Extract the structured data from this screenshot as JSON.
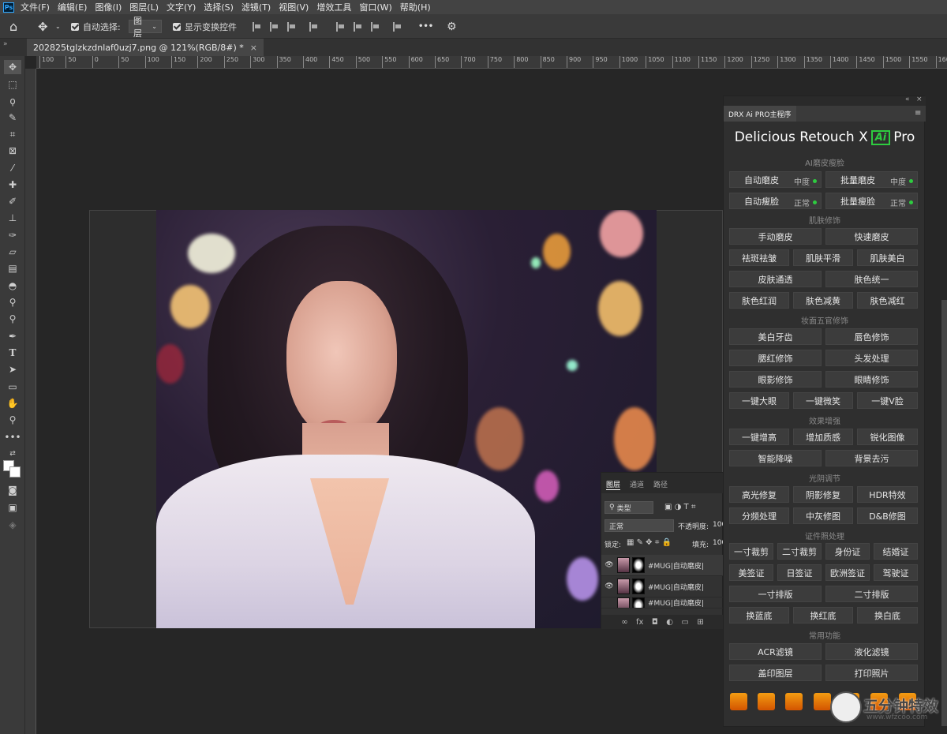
{
  "menu": [
    "文件(F)",
    "编辑(E)",
    "图像(I)",
    "图层(L)",
    "文字(Y)",
    "选择(S)",
    "滤镜(T)",
    "视图(V)",
    "增效工具",
    "窗口(W)",
    "帮助(H)"
  ],
  "options": {
    "auto_select_label": "自动选择:",
    "auto_select_value": "图层",
    "show_transform_label": "显示变换控件",
    "more": "•••"
  },
  "document_tab": {
    "title": "202825tglzkzdnlaf0uzj7.png @ 121%(RGB/8#) *",
    "close": "×"
  },
  "ruler_ticks": [
    "100",
    "50",
    "0",
    "50",
    "100",
    "150",
    "200",
    "250",
    "300",
    "350",
    "400",
    "450",
    "500",
    "550",
    "600",
    "650",
    "700",
    "750",
    "800",
    "850",
    "900",
    "950",
    "1000",
    "1050",
    "1100",
    "1150",
    "1200",
    "1250",
    "1300",
    "1350",
    "1400",
    "1450",
    "1500",
    "1550",
    "1600"
  ],
  "layers_panel": {
    "tabs": [
      "图层",
      "通道",
      "路径"
    ],
    "filter_label": "类型",
    "blend_mode": "正常",
    "opacity_label": "不透明度:",
    "opacity_value": "100",
    "lock_label": "锁定:",
    "fill_label": "填充:",
    "fill_value": "100",
    "layers": [
      {
        "name": "#MUG|自动磨皮|"
      },
      {
        "name": "#MUG|自动磨皮|"
      },
      {
        "name": "#MUG|自动磨皮|"
      }
    ]
  },
  "drx": {
    "tab_label": "DRX Ai PRO主程序",
    "title_left": "Delicious Retouch X",
    "title_badge": "Ai",
    "title_right": "Pro",
    "sections": {
      "ai": "AI磨皮瘦脸",
      "skin": "肌肤修饰",
      "makeup": "妆面五官修饰",
      "effect": "效果增强",
      "light": "光阴调节",
      "id": "证件照处理",
      "common": "常用功能"
    },
    "ai_buttons": [
      {
        "label": "自动磨皮",
        "mode": "中度"
      },
      {
        "label": "批量磨皮",
        "mode": "中度"
      },
      {
        "label": "自动瘦脸",
        "mode": "正常"
      },
      {
        "label": "批量瘦脸",
        "mode": "正常"
      }
    ],
    "skin_buttons": [
      "手动磨皮",
      "快速磨皮",
      "祛斑祛皱",
      "肌肤平滑",
      "肌肤美白",
      "皮肤通透",
      "肤色统一",
      "肤色红润",
      "肤色减黄",
      "肤色减红"
    ],
    "makeup_buttons": [
      "美白牙齿",
      "唇色修饰",
      "腮红修饰",
      "头发处理",
      "眼影修饰",
      "眼睛修饰",
      "一键大眼",
      "一键微笑",
      "一键V脸"
    ],
    "effect_buttons": [
      "一键增高",
      "增加质感",
      "锐化图像",
      "智能降噪",
      "背景去污"
    ],
    "light_buttons": [
      "高光修复",
      "阴影修复",
      "HDR特效",
      "分频处理",
      "中灰修图",
      "D&B修图"
    ],
    "id_buttons": [
      "一寸裁剪",
      "二寸裁剪",
      "身份证",
      "结婚证",
      "美签证",
      "日签证",
      "欧洲签证",
      "驾驶证",
      "一寸排版",
      "二寸排版",
      "换蓝底",
      "换红底",
      "换白底"
    ],
    "common_buttons": [
      "ACR滤镜",
      "液化滤镜",
      "盖印图层",
      "打印照片"
    ]
  },
  "watermark": {
    "text": "五分钟特效",
    "url": "www.wfzcoo.com"
  }
}
